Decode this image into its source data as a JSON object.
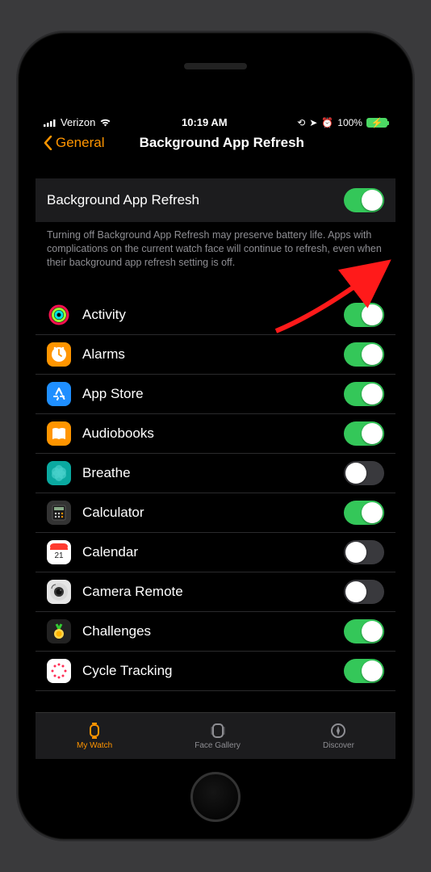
{
  "statusBar": {
    "carrier": "Verizon",
    "time": "10:19 AM",
    "battery": "100%"
  },
  "nav": {
    "back": "General",
    "title": "Background App Refresh"
  },
  "master": {
    "label": "Background App Refresh",
    "on": true
  },
  "description": "Turning off Background App Refresh may preserve battery life. Apps with complications on the current watch face will continue to refresh, even when their background app refresh setting is off.",
  "apps": [
    {
      "id": "activity",
      "label": "Activity",
      "on": true,
      "icon": {
        "bg": "#000",
        "type": "rings"
      }
    },
    {
      "id": "alarms",
      "label": "Alarms",
      "on": true,
      "icon": {
        "bg": "#ff9500",
        "type": "clock"
      }
    },
    {
      "id": "appstore",
      "label": "App Store",
      "on": true,
      "icon": {
        "bg": "#1f8fff",
        "type": "appstore"
      }
    },
    {
      "id": "audiobooks",
      "label": "Audiobooks",
      "on": true,
      "icon": {
        "bg": "#ff9500",
        "type": "book"
      }
    },
    {
      "id": "breathe",
      "label": "Breathe",
      "on": false,
      "icon": {
        "bg": "#0aa9a0",
        "type": "breathe"
      }
    },
    {
      "id": "calculator",
      "label": "Calculator",
      "on": true,
      "icon": {
        "bg": "#333",
        "type": "calc"
      }
    },
    {
      "id": "calendar",
      "label": "Calendar",
      "on": false,
      "icon": {
        "bg": "#fff",
        "type": "calendar"
      }
    },
    {
      "id": "cameraremote",
      "label": "Camera Remote",
      "on": false,
      "icon": {
        "bg": "#e5e5e5",
        "type": "camera"
      }
    },
    {
      "id": "challenges",
      "label": "Challenges",
      "on": true,
      "icon": {
        "bg": "#222",
        "type": "medal"
      }
    },
    {
      "id": "cycletracking",
      "label": "Cycle Tracking",
      "on": true,
      "icon": {
        "bg": "#fff",
        "type": "cycle"
      }
    }
  ],
  "tabs": [
    {
      "id": "mywatch",
      "label": "My Watch",
      "active": true
    },
    {
      "id": "facegallery",
      "label": "Face Gallery",
      "active": false
    },
    {
      "id": "discover",
      "label": "Discover",
      "active": false
    }
  ]
}
